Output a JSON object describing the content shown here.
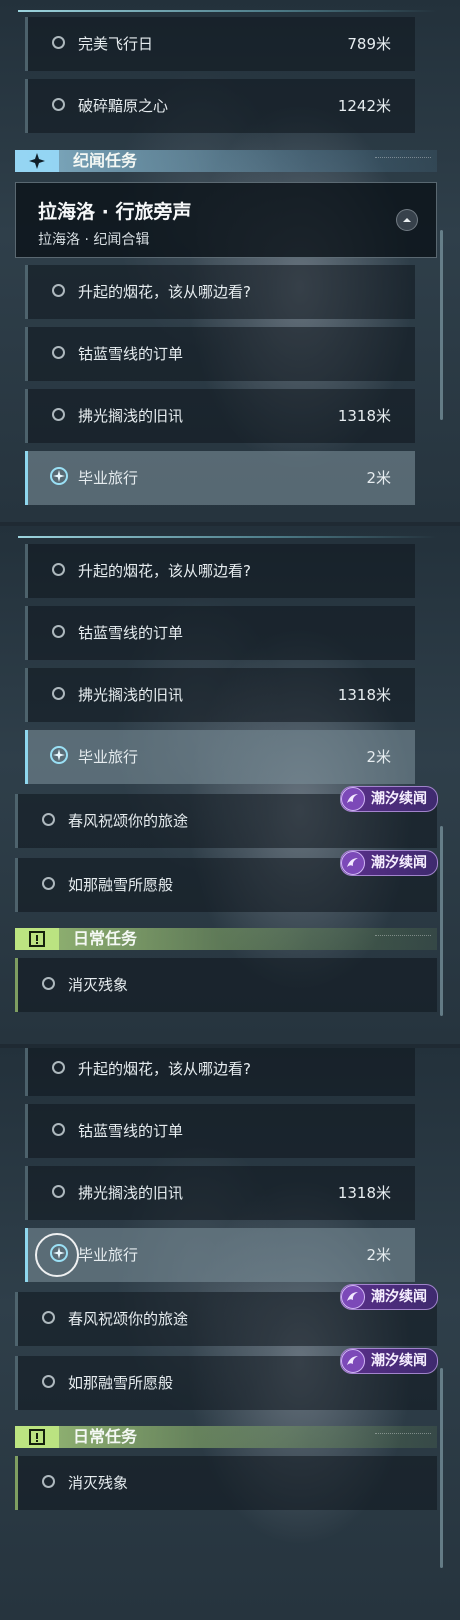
{
  "panel1": {
    "items_top": [
      {
        "label": "完美飞行日",
        "distance": "789米"
      },
      {
        "label": "破碎黯原之心",
        "distance": "1242米"
      }
    ],
    "story_section": {
      "title": "纪闻任务"
    },
    "story_card": {
      "title": "拉海洛 · 行旅旁声",
      "subtitle": "拉海洛 · 纪闻合辑"
    },
    "items": [
      {
        "label": "升起的烟花，该从哪边看?",
        "distance": ""
      },
      {
        "label": "钴蓝雪线的订单",
        "distance": ""
      },
      {
        "label": "拂光搁浅的旧讯",
        "distance": "1318米"
      },
      {
        "label": "毕业旅行",
        "distance": "2米",
        "active": true
      }
    ]
  },
  "panel2": {
    "items": [
      {
        "label": "升起的烟花，该从哪边看?",
        "distance": ""
      },
      {
        "label": "钴蓝雪线的订单",
        "distance": ""
      },
      {
        "label": "拂光搁浅的旧讯",
        "distance": "1318米"
      },
      {
        "label": "毕业旅行",
        "distance": "2米",
        "active": true
      },
      {
        "label": "春风祝颂你的旅途",
        "distance": "",
        "badge": "潮汐续闻"
      },
      {
        "label": "如那融雪所愿般",
        "distance": "",
        "badge": "潮汐续闻"
      }
    ],
    "daily_section": {
      "title": "日常任务"
    },
    "daily_items": [
      {
        "label": "消灭残象"
      }
    ]
  },
  "panel3": {
    "items": [
      {
        "label": "升起的烟花，该从哪边看?",
        "distance": ""
      },
      {
        "label": "钴蓝雪线的订单",
        "distance": ""
      },
      {
        "label": "拂光搁浅的旧讯",
        "distance": "1318米"
      },
      {
        "label": "毕业旅行",
        "distance": "2米",
        "active": true
      },
      {
        "label": "春风祝颂你的旅途",
        "distance": "",
        "badge": "潮汐续闻"
      },
      {
        "label": "如那融雪所愿般",
        "distance": "",
        "badge": "潮汐续闻"
      }
    ],
    "daily_section": {
      "title": "日常任务"
    },
    "daily_items": [
      {
        "label": "消灭残象"
      }
    ]
  },
  "icons": {
    "story": "sparkle-icon",
    "daily": "alert-box-icon",
    "track": "target-icon",
    "badge": "tide-swirl-icon",
    "collapse": "chevron-up-icon"
  },
  "colors": {
    "active_accent": "#8fd7ee",
    "story_accent": "#96d7f5",
    "daily_accent": "#bee682",
    "badge": "#5a2f8a"
  }
}
